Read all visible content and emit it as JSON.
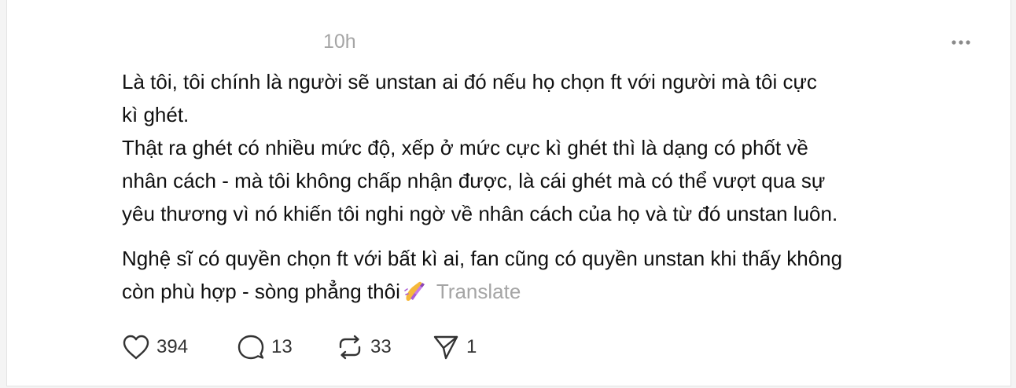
{
  "post": {
    "timestamp": "10h",
    "paragraph_1_line_1": "Là tôi, tôi chính là người sẽ unstan ai đó nếu họ chọn ft với người mà tôi cực",
    "paragraph_1_line_2": "kì ghét.",
    "paragraph_2_line_1": "Thật ra ghét có nhiều mức độ, xếp ở mức cực kì ghét thì là dạng có phốt về",
    "paragraph_2_line_2": "nhân cách - mà tôi không chấp nhận được, là cái ghét mà có thể vượt qua sự",
    "paragraph_2_line_3": "yêu thương vì nó khiến tôi nghi ngờ về nhân cách của họ và từ đó unstan luôn.",
    "paragraph_3_line_1": "Nghệ sĩ có quyền chọn ft với bất kì ai, fan cũng có quyền unstan khi thấy không",
    "paragraph_3_line_2": "còn phù hợp - sòng phẳng thôi",
    "emoji": "nail-polish-emoji",
    "translate_label": "Translate"
  },
  "actions": {
    "likes": "394",
    "replies": "13",
    "reposts": "33",
    "shares": "1"
  },
  "icons": {
    "more": "more-horizontal-icon",
    "like": "heart-icon",
    "reply": "comment-bubble-icon",
    "repost": "repost-icon",
    "share": "send-icon"
  },
  "colors": {
    "text": "#101010",
    "muted": "#a5a5a5",
    "emoji_nail": "#f5b83b",
    "emoji_polish": "#a95cd6"
  }
}
